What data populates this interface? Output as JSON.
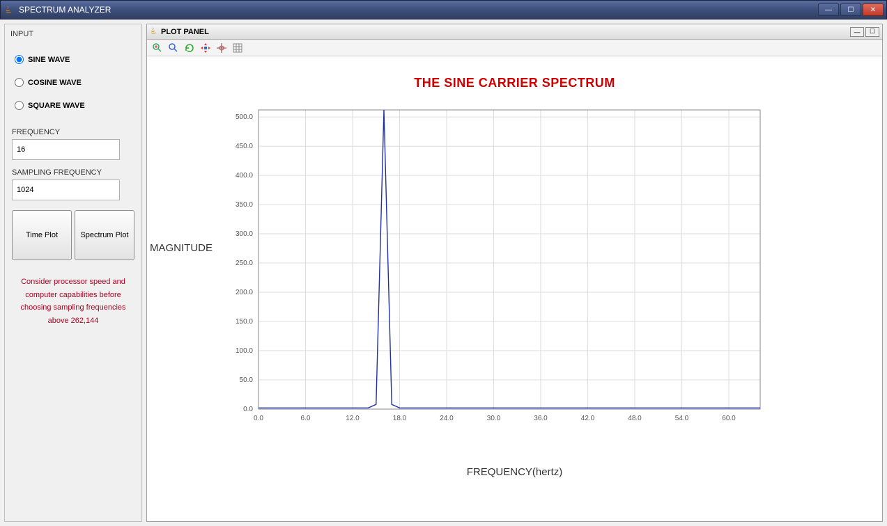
{
  "window": {
    "title": "SPECTRUM ANALYZER"
  },
  "input": {
    "panel_title": "INPUT",
    "radios": {
      "sine": "SINE WAVE",
      "cosine": "COSINE WAVE",
      "square": "SQUARE WAVE",
      "selected": "sine"
    },
    "frequency_label": "FREQUENCY",
    "frequency_value": "16",
    "sampling_label": "SAMPLING FREQUENCY",
    "sampling_value": "1024",
    "time_plot_btn": "Time Plot",
    "spectrum_plot_btn": "Spectrum Plot",
    "warning": "Consider processor speed and computer capabilities before choosing sampling frequencies above 262,144"
  },
  "plot_panel": {
    "title": "PLOT PANEL"
  },
  "toolbar_icons": [
    "search-plus-icon",
    "search-icon",
    "refresh-icon",
    "pan-icon",
    "crosshair-icon",
    "grid-icon"
  ],
  "chart_data": {
    "type": "line",
    "title": "THE SINE CARRIER SPECTRUM",
    "xlabel": "FREQUENCY(hertz)",
    "ylabel": "MAGNITUDE",
    "xlim": [
      0,
      64
    ],
    "ylim": [
      0,
      512
    ],
    "xticks": [
      0.0,
      6.0,
      12.0,
      18.0,
      24.0,
      30.0,
      36.0,
      42.0,
      48.0,
      54.0,
      60.0
    ],
    "yticks": [
      0.0,
      50.0,
      100.0,
      150.0,
      200.0,
      250.0,
      300.0,
      350.0,
      400.0,
      450.0,
      500.0
    ],
    "series": [
      {
        "name": "spectrum",
        "x": [
          0,
          14,
          15,
          16,
          17,
          18,
          64
        ],
        "values": [
          2,
          2,
          8,
          512,
          8,
          2,
          2
        ]
      }
    ]
  }
}
